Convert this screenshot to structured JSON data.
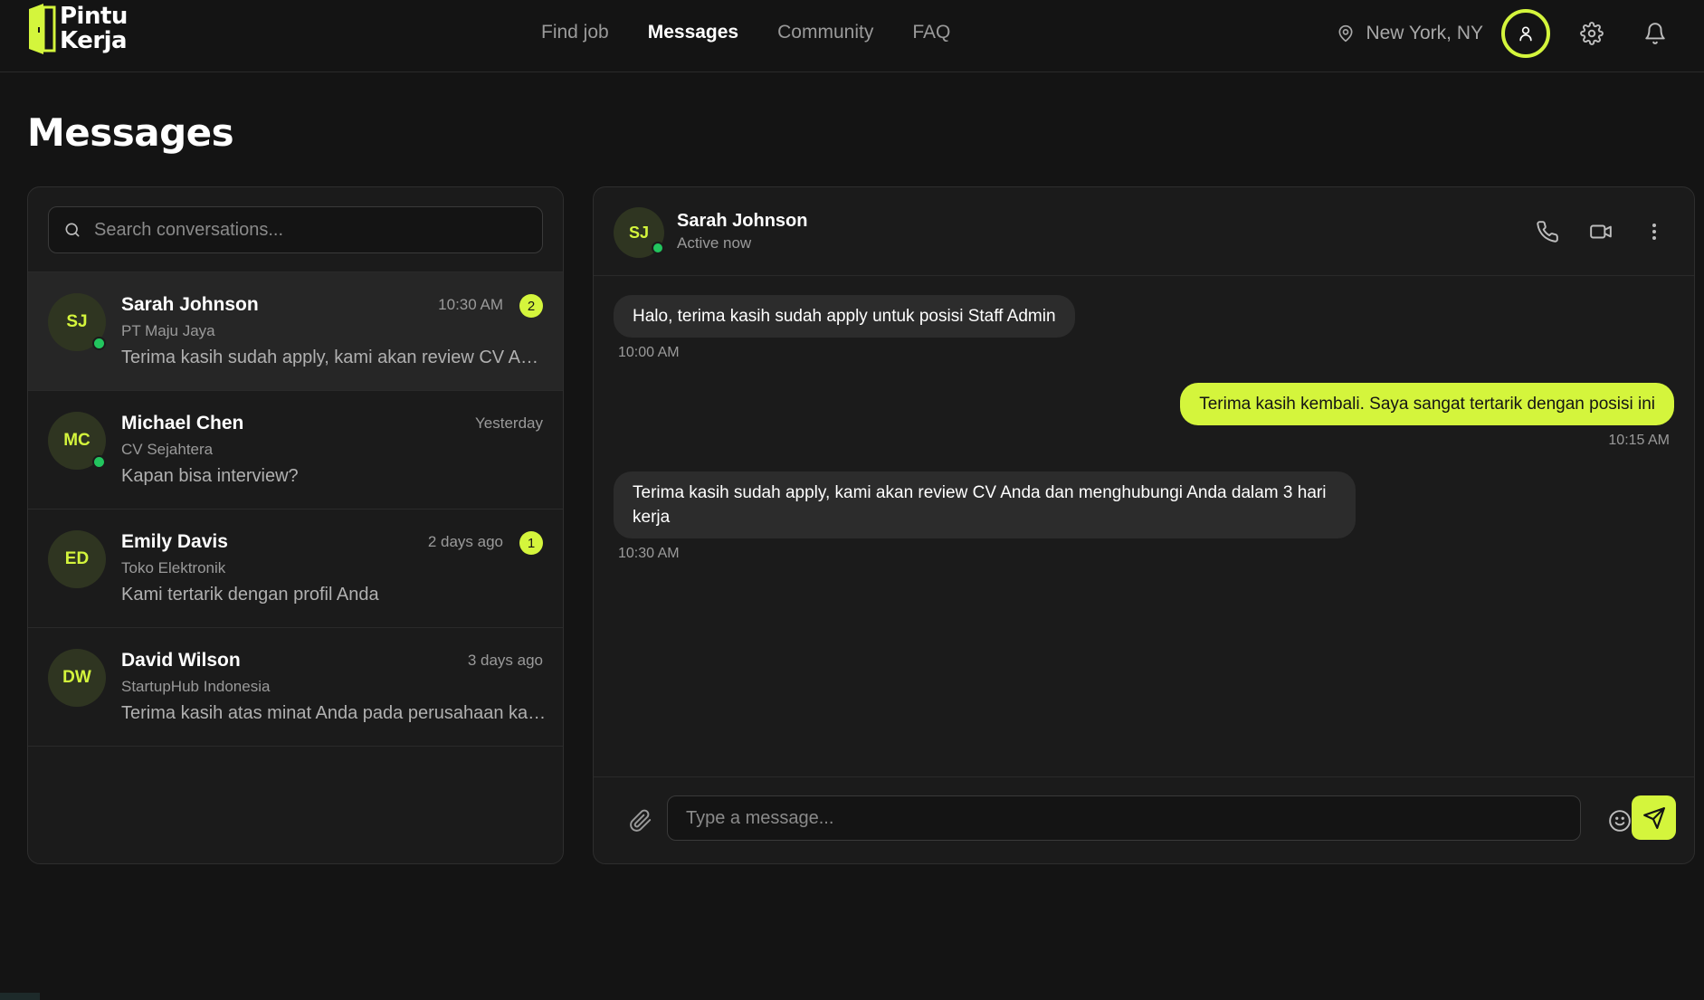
{
  "brand": {
    "line1": "Pintu",
    "line2": "Kerja",
    "accent": "#d4f53c"
  },
  "nav": [
    {
      "label": "Find job",
      "active": false
    },
    {
      "label": "Messages",
      "active": true
    },
    {
      "label": "Community",
      "active": false
    },
    {
      "label": "FAQ",
      "active": false
    }
  ],
  "header": {
    "location": "New York, NY"
  },
  "page": {
    "title": "Messages"
  },
  "search": {
    "placeholder": "Search conversations..."
  },
  "conversations": [
    {
      "initials": "SJ",
      "name": "Sarah Johnson",
      "company": "PT Maju Jaya",
      "preview": "Terima kasih sudah apply, kami akan review CV Anda dan menghubungi Anda dalam 3 hari kerja",
      "time": "10:30 AM",
      "unread": "2",
      "online": true,
      "selected": true
    },
    {
      "initials": "MC",
      "name": "Michael Chen",
      "company": "CV Sejahtera",
      "preview": "Kapan bisa interview?",
      "time": "Yesterday",
      "unread": "",
      "online": true,
      "selected": false
    },
    {
      "initials": "ED",
      "name": "Emily Davis",
      "company": "Toko Elektronik",
      "preview": "Kami tertarik dengan profil Anda",
      "time": "2 days ago",
      "unread": "1",
      "online": false,
      "selected": false
    },
    {
      "initials": "DW",
      "name": "David Wilson",
      "company": "StartupHub Indonesia",
      "preview": "Terima kasih atas minat Anda pada perusahaan kami",
      "time": "3 days ago",
      "unread": "",
      "online": false,
      "selected": false
    }
  ],
  "chat": {
    "initials": "SJ",
    "name": "Sarah Johnson",
    "status": "Active now",
    "messages": [
      {
        "direction": "in",
        "text": "Halo, terima kasih sudah apply untuk posisi Staff Admin",
        "time": "10:00 AM"
      },
      {
        "direction": "out",
        "text": "Terima kasih kembali. Saya sangat tertarik dengan posisi ini",
        "time": "10:15 AM"
      },
      {
        "direction": "in",
        "text": "Terima kasih sudah apply, kami akan review CV Anda dan menghubungi Anda dalam 3 hari kerja",
        "time": "10:30 AM"
      }
    ],
    "composer_placeholder": "Type a message..."
  },
  "icons": {
    "location": "map-pin-icon",
    "profile": "user-icon",
    "settings": "gear-icon",
    "notifications": "bell-icon",
    "search": "search-icon",
    "call": "phone-icon",
    "video": "video-camera-icon",
    "more": "more-vertical-icon",
    "attach": "paperclip-icon",
    "emoji": "smiley-icon",
    "send": "send-icon"
  }
}
